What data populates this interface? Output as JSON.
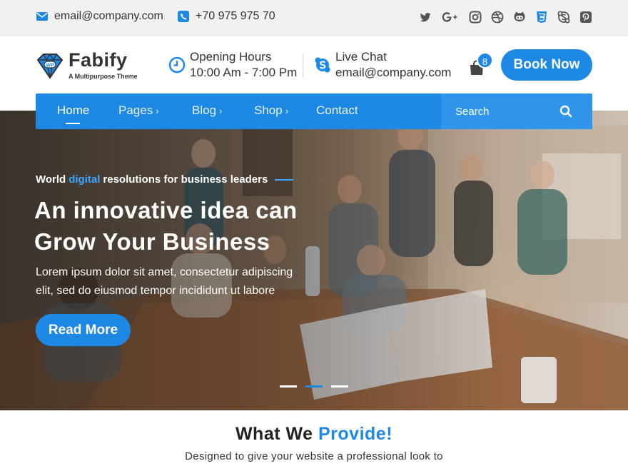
{
  "topbar": {
    "email": "email@company.com",
    "phone": "+70 975 975 70",
    "social_icons": [
      "twitter-icon",
      "google-plus-icon",
      "instagram-icon",
      "dribbble-icon",
      "github-icon",
      "css3-icon",
      "skype-icon",
      "pinterest-icon"
    ]
  },
  "header": {
    "logo_name": "Fabify",
    "logo_tagline": "A Multipurpose Theme",
    "logo_badge": "WP",
    "hours_title": "Opening Hours",
    "hours_value": "10:00 Am - 7:00 Pm",
    "chat_title": "Live Chat",
    "chat_value": "email@company.com",
    "cart_count": "8",
    "book_label": "Book Now"
  },
  "nav": {
    "items": [
      {
        "label": "Home",
        "active": true,
        "has_dropdown": false
      },
      {
        "label": "Pages",
        "active": false,
        "has_dropdown": true
      },
      {
        "label": "Blog",
        "active": false,
        "has_dropdown": true
      },
      {
        "label": "Shop",
        "active": false,
        "has_dropdown": true
      },
      {
        "label": "Contact",
        "active": false,
        "has_dropdown": false
      }
    ],
    "search_placeholder": "Search"
  },
  "hero": {
    "eyebrow_pre": "World",
    "eyebrow_highlight": "digital",
    "eyebrow_post": "resolutions for business leaders",
    "headline_line1": "An innovative idea can",
    "headline_line2": "Grow Your Business",
    "lead_line1": "Lorem ipsum dolor sit amet, consectetur adipiscing",
    "lead_line2": "elit, sed do eiusmod tempor incididunt ut labore",
    "button_label": "Read More",
    "slides_total": 3,
    "slide_active": 2
  },
  "section": {
    "title_pre": "What We",
    "title_highlight": "Provide!",
    "subtitle": "Designed to give your website a professional look to"
  },
  "colors": {
    "accent": "#1e88e5",
    "accent_light": "#3ea6ff",
    "topbar_bg": "#f1f1f1"
  }
}
